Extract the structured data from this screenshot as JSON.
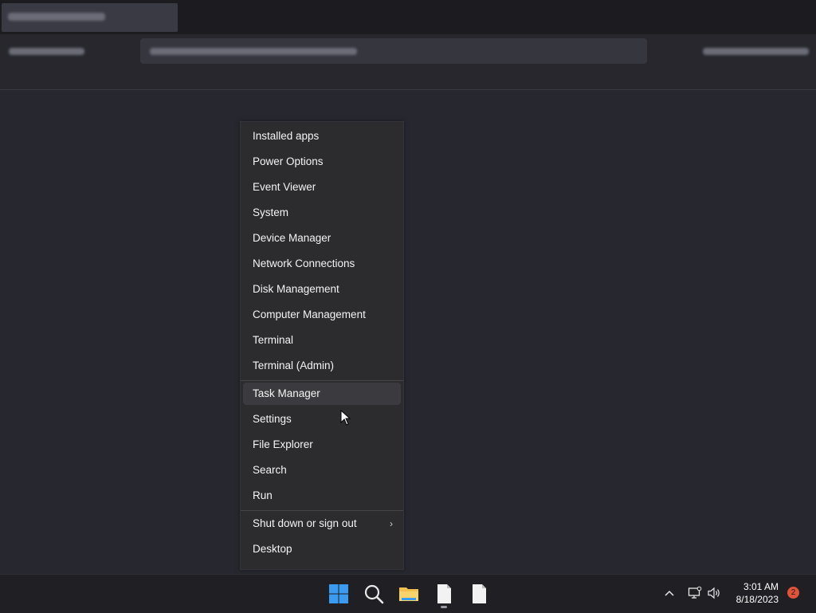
{
  "menu": {
    "items": [
      {
        "label": "Installed apps"
      },
      {
        "label": "Power Options"
      },
      {
        "label": "Event Viewer"
      },
      {
        "label": "System"
      },
      {
        "label": "Device Manager"
      },
      {
        "label": "Network Connections"
      },
      {
        "label": "Disk Management"
      },
      {
        "label": "Computer Management"
      },
      {
        "label": "Terminal"
      },
      {
        "label": "Terminal (Admin)"
      },
      {
        "label": "Task Manager"
      },
      {
        "label": "Settings"
      },
      {
        "label": "File Explorer"
      },
      {
        "label": "Search"
      },
      {
        "label": "Run"
      },
      {
        "label": "Shut down or sign out"
      },
      {
        "label": "Desktop"
      }
    ],
    "submenu_indicator": "›"
  },
  "taskbar": {
    "icons": [
      "windows-start-icon",
      "search-icon",
      "file-explorer-icon",
      "document-icon",
      "document-icon"
    ],
    "tray": {
      "time": "3:01 AM",
      "date": "8/18/2023",
      "notification_count": "2"
    }
  },
  "colors": {
    "desktop_bg": "#27272f",
    "menu_bg": "#2c2c2f",
    "accent_blue": "#3a9bf0",
    "folder_yellow": "#f2c14e",
    "badge_red": "#e0533b"
  }
}
